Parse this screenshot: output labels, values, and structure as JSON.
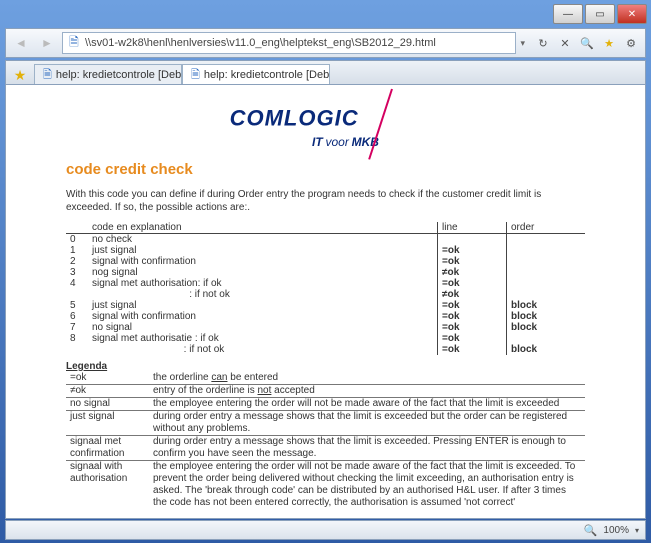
{
  "window": {
    "url": "\\\\sv01-w2k8\\henl\\henlversies\\v11.0_eng\\helptekst_eng\\SB2012_29.html"
  },
  "tabs": {
    "fav_label": "",
    "tab1_label": "help: kredietcontrole [Debiteur...",
    "tab2_label": "help: kredietcontrole [Debit..."
  },
  "logo": {
    "brand": "COMLOGIC",
    "sub1": "IT",
    "sub2": "voor",
    "sub3": "MKB"
  },
  "page": {
    "title": "code credit check",
    "intro": "With this code you can define if during Order entry the program needs to check if the customer credit limit is exceeded. If so, the possible actions are:."
  },
  "table": {
    "hdr_code": "code en explanation",
    "hdr_line": "line",
    "hdr_order": "order",
    "rows": [
      {
        "n": "0",
        "expl": "no check",
        "line": "",
        "order": ""
      },
      {
        "n": "1",
        "expl": "just signal",
        "line": "=ok",
        "order": ""
      },
      {
        "n": "2",
        "expl": "signal with confirmation",
        "line": "=ok",
        "order": ""
      },
      {
        "n": "3",
        "expl": "nog signal",
        "line": "≠ok",
        "order": ""
      },
      {
        "n": "4",
        "expl": "signal met authorisation: if ok",
        "line": "=ok",
        "order": ""
      },
      {
        "n": "",
        "expl": "                                   : if not ok",
        "line": "≠ok",
        "order": ""
      },
      {
        "n": "5",
        "expl": "just signal",
        "line": "=ok",
        "order": "block"
      },
      {
        "n": "6",
        "expl": "signal with confirmation",
        "line": "=ok",
        "order": "block"
      },
      {
        "n": "7",
        "expl": "no signal",
        "line": "=ok",
        "order": "block"
      },
      {
        "n": "8",
        "expl": "signal met authorisatie   : if ok",
        "line": "=ok",
        "order": ""
      },
      {
        "n": "",
        "expl": "                                 : if not ok",
        "line": "=ok",
        "order": "block"
      }
    ]
  },
  "legend": {
    "title": "Legenda",
    "rows": [
      {
        "k": "=ok",
        "v_pre": "the orderline ",
        "v_u": "can",
        "v_post": " be entered"
      },
      {
        "k": "≠ok",
        "v_pre": "entry of the orderline is ",
        "v_u": "not",
        "v_post": " accepted"
      },
      {
        "k": "no signal",
        "v_pre": "the employee entering the order will not be made aware of the fact that the limit is exceeded",
        "v_u": "",
        "v_post": ""
      },
      {
        "k": "just signal",
        "v_pre": "during order entry a message shows that the limit is exceeded but the order can be registered without any problems.",
        "v_u": "",
        "v_post": ""
      },
      {
        "k": "signaal met confirmation",
        "v_pre": "during order entry a message shows that the limit is exceeded. Pressing ENTER is enough to confirm you have seen the message.",
        "v_u": "",
        "v_post": ""
      },
      {
        "k": "signaal with authorisation",
        "v_pre": "the employee entering the order will not be made aware of the fact that the limit is exceeded. To prevent the order being delivered without checking the limit exceeding, an authorisation entry is asked. The 'break through code' can be distributed by an authorised H&L user. If after 3 times the code has not been entered correctly, the authorisation is assumed 'not correct'",
        "v_u": "",
        "v_post": ""
      }
    ]
  },
  "status": {
    "zoom": "100%"
  }
}
